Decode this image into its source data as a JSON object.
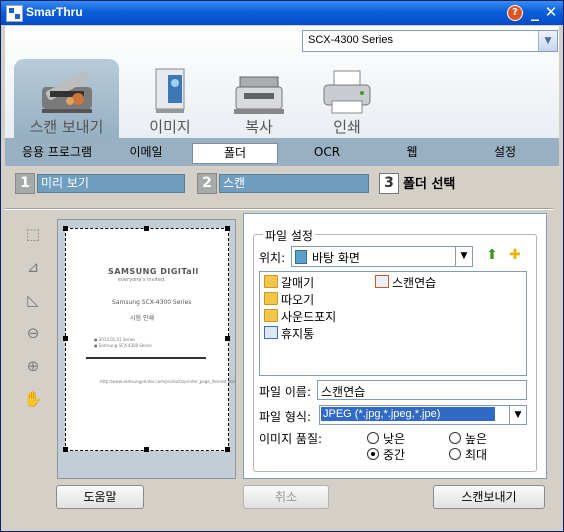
{
  "window": {
    "title": "SmarThru"
  },
  "device": {
    "selected": "SCX-4300 Series"
  },
  "main_tabs": [
    {
      "label": "스캔 보내기",
      "icon": "scanner-icon"
    },
    {
      "label": "이미지",
      "icon": "image-document-icon"
    },
    {
      "label": "복사",
      "icon": "copier-icon"
    },
    {
      "label": "인쇄",
      "icon": "printer-icon"
    }
  ],
  "sub_tabs": [
    {
      "label": "응용 프로그램"
    },
    {
      "label": "이메일"
    },
    {
      "label": "폴더",
      "selected": true
    },
    {
      "label": "OCR"
    },
    {
      "label": "웹"
    },
    {
      "label": "설정"
    }
  ],
  "steps": [
    {
      "number": "1",
      "label": "미리 보기"
    },
    {
      "number": "2",
      "label": "스캔"
    },
    {
      "number": "3",
      "label": "폴더 선택"
    }
  ],
  "preview": {
    "brand": "SAMSUNG DIGITall",
    "tagline": "everyone's invited.",
    "line1": "Samsung SCX-4300 Series",
    "line2": "시험 인쇄",
    "bullet1": "● 2013.01.01 Series",
    "bullet2": "● Samsung SCX-4300 Series",
    "url": "http://www.samsungprinter.com/products/printer_page_itemlist.htm"
  },
  "file_settings": {
    "legend": "파일 설정",
    "location_label": "위치:",
    "location_value": "바탕 화면",
    "items": [
      {
        "name": "갈매기",
        "type": "folder"
      },
      {
        "name": "스캔연습",
        "type": "image"
      },
      {
        "name": "따오기",
        "type": "folder"
      },
      {
        "name": "사운드포지",
        "type": "folder"
      },
      {
        "name": "휴지통",
        "type": "recycle-bin"
      }
    ],
    "filename_label": "파일 이름:",
    "filename_value": "스캔연습",
    "format_label": "파일 형식:",
    "format_value": "JPEG (*.jpg,*.jpeg,*.jpe)",
    "quality_label": "이미지 품질:",
    "quality_options": [
      {
        "label": "낮은",
        "checked": false
      },
      {
        "label": "높은",
        "checked": false
      },
      {
        "label": "중간",
        "checked": true
      },
      {
        "label": "최대",
        "checked": false
      }
    ]
  },
  "buttons": {
    "help": "도움말",
    "cancel": "취소",
    "send": "스캔보내기"
  }
}
